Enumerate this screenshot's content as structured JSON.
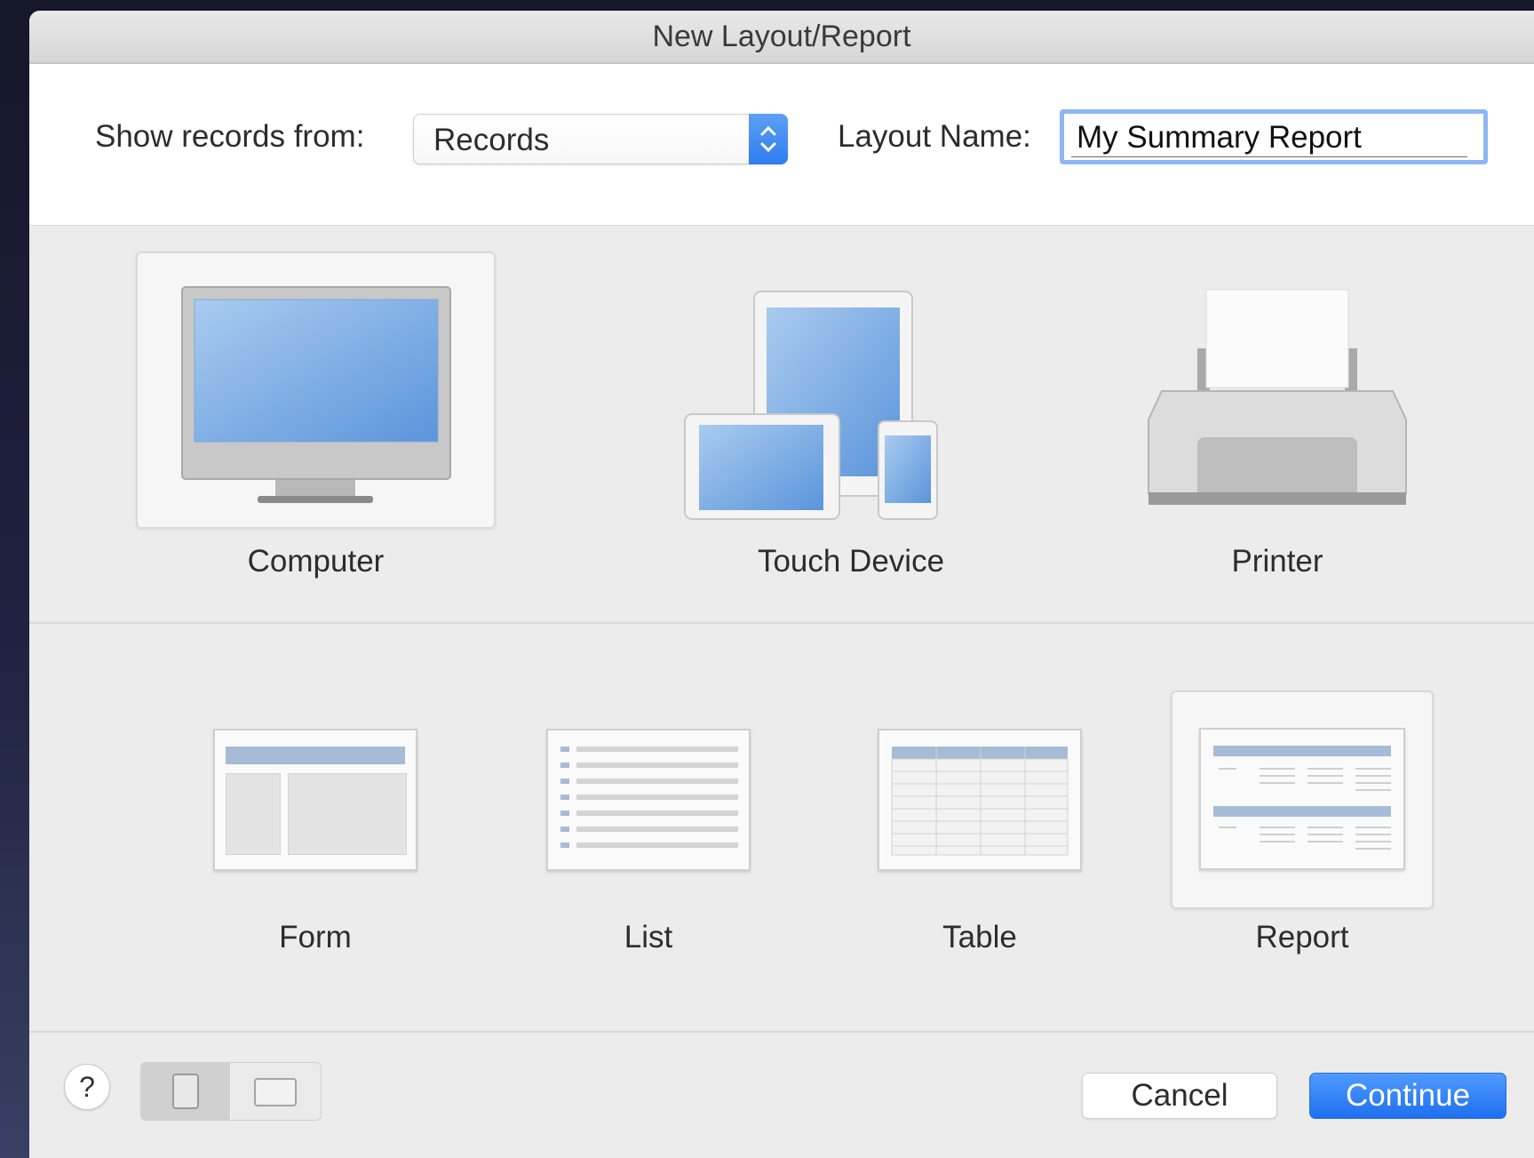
{
  "window": {
    "title": "New Layout/Report"
  },
  "form": {
    "show_records_label": "Show records from:",
    "show_records_value": "Records",
    "layout_name_label": "Layout Name:",
    "layout_name_value": "My Summary Report"
  },
  "devices": [
    {
      "label": "Computer",
      "icon": "computer-icon",
      "selected": true
    },
    {
      "label": "Touch Device",
      "icon": "touch-device-icon",
      "selected": false
    },
    {
      "label": "Printer",
      "icon": "printer-icon",
      "selected": false
    }
  ],
  "layout_types": [
    {
      "label": "Form",
      "icon": "form-layout-icon",
      "selected": false
    },
    {
      "label": "List",
      "icon": "list-layout-icon",
      "selected": false
    },
    {
      "label": "Table",
      "icon": "table-layout-icon",
      "selected": false
    },
    {
      "label": "Report",
      "icon": "report-layout-icon",
      "selected": true
    }
  ],
  "footer": {
    "help_label": "?",
    "orientation_options": [
      "portrait-icon",
      "landscape-icon"
    ],
    "cancel_label": "Cancel",
    "continue_label": "Continue"
  },
  "colors": {
    "accent": "#2e7cf0",
    "screen_blue": "#6ea3e0",
    "focus_ring": "#8db6f3"
  }
}
